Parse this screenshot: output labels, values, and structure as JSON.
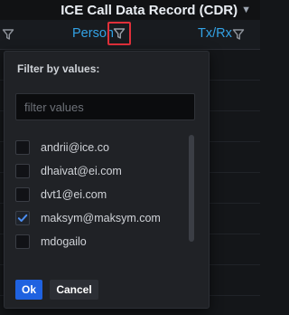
{
  "panel": {
    "title": "ICE Call Data Record (CDR)",
    "title_caret_icon": "chevron-down-icon"
  },
  "table": {
    "columns": [
      {
        "label": "",
        "filter_icon": "funnel-icon"
      },
      {
        "label": "Person",
        "filter_icon": "funnel-icon",
        "filter_active": true
      },
      {
        "label": "Tx/Rx",
        "filter_icon": "funnel-icon"
      }
    ]
  },
  "filter_popup": {
    "title": "Filter by values:",
    "search": {
      "value": "",
      "placeholder": "filter values"
    },
    "values": [
      {
        "label": "andrii@ice.co",
        "checked": false
      },
      {
        "label": "dhaivat@ei.com",
        "checked": false
      },
      {
        "label": "dvt1@ei.com",
        "checked": false
      },
      {
        "label": "maksym@maksym.com",
        "checked": true
      },
      {
        "label": "mdogailo",
        "checked": false
      }
    ],
    "ok_label": "Ok",
    "cancel_label": "Cancel"
  },
  "colors": {
    "background": "#141619",
    "header_link": "#33a2e5",
    "active_highlight": "#e0303a",
    "checkmark": "#4b8ef2",
    "primary_button": "#1f62e0"
  }
}
